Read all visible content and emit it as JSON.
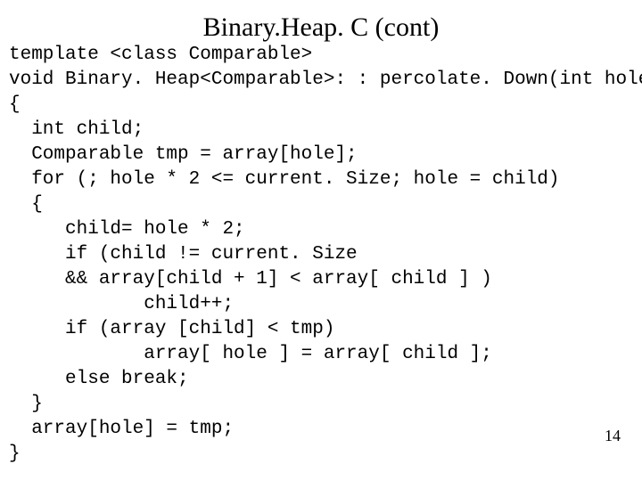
{
  "title": "Binary.Heap. C (cont)",
  "page_number": "14",
  "code_lines": [
    "template <class Comparable>",
    "void Binary. Heap<Comparable>: : percolate. Down(int hole)",
    "{",
    "  int child;",
    "  Comparable tmp = array[hole];",
    "  for (; hole * 2 <= current. Size; hole = child)",
    "  {",
    "     child= hole * 2;",
    "     if (child != current. Size",
    "     && array[child + 1] < array[ child ] )",
    "            child++;",
    "     if (array [child] < tmp)",
    "            array[ hole ] = array[ child ];",
    "     else break;",
    "  }",
    "  array[hole] = tmp;",
    "}"
  ]
}
